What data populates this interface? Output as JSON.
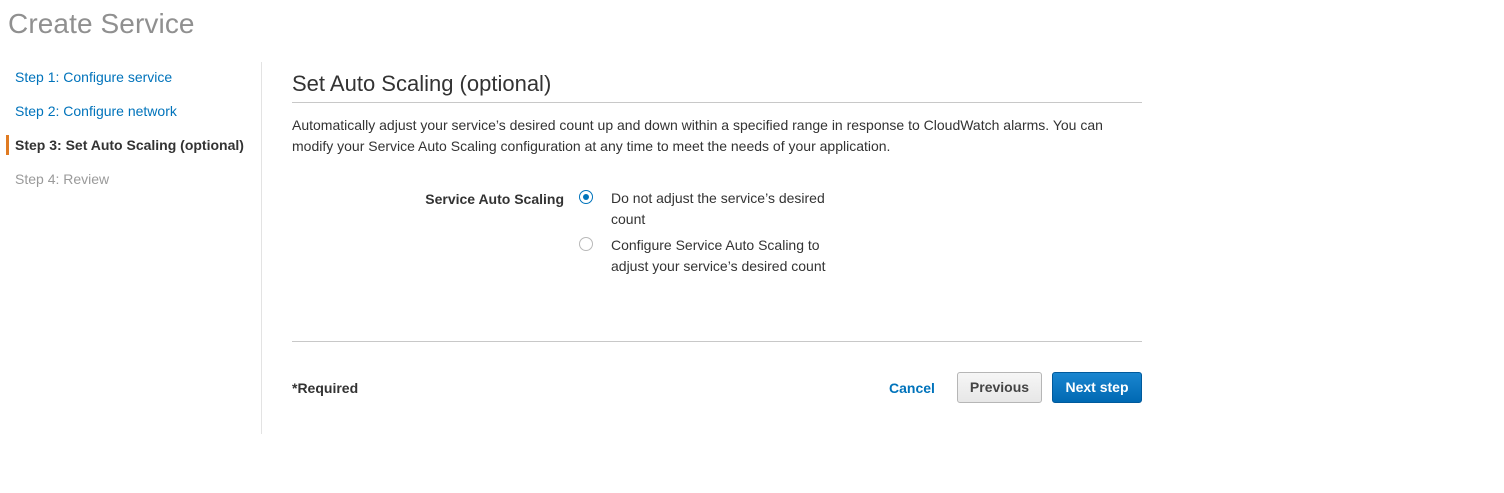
{
  "page": {
    "title": "Create Service"
  },
  "steps": [
    {
      "label": "Step 1: Configure service",
      "state": "link"
    },
    {
      "label": "Step 2: Configure network",
      "state": "link"
    },
    {
      "label": "Step 3: Set Auto Scaling (optional)",
      "state": "active"
    },
    {
      "label": "Step 4: Review",
      "state": "disabled"
    }
  ],
  "section": {
    "title": "Set Auto Scaling (optional)",
    "description": "Automatically adjust your service’s desired count up and down within a specified range in response to CloudWatch alarms. You can modify your Service Auto Scaling configuration at any time to meet the needs of your application."
  },
  "auto_scaling": {
    "label": "Service Auto Scaling",
    "options": [
      {
        "label": "Do not adjust the service’s desired count",
        "checked": true
      },
      {
        "label": "Configure Service Auto Scaling to adjust your service’s desired count",
        "checked": false
      }
    ]
  },
  "footer": {
    "required_note": "*Required",
    "cancel_label": "Cancel",
    "previous_label": "Previous",
    "next_label": "Next step"
  },
  "colors": {
    "link": "#0073bb",
    "active_step_marker": "#e07b22",
    "primary_button": "#0073bb"
  }
}
